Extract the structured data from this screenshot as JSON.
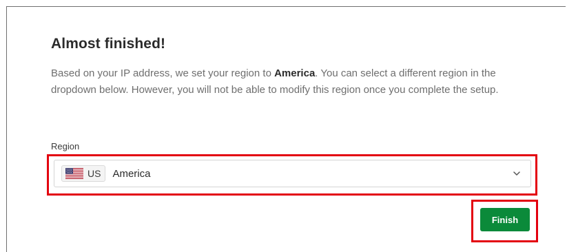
{
  "dialog": {
    "title": "Almost finished!",
    "description_before": "Based on your IP address, we set your region to ",
    "description_region": "America",
    "description_after": ". You can select a different region in the dropdown below. However, you will not be able to modify this region once you complete the setup."
  },
  "region_field": {
    "label": "Region",
    "selected_code": "US",
    "selected_name": "America",
    "flag_icon": "us-flag-icon",
    "dropdown_icon": "chevron-down-icon"
  },
  "actions": {
    "finish_label": "Finish"
  },
  "colors": {
    "accent_green": "#0b8a3a",
    "highlight_red": "#e3000f",
    "title_text": "#2b2b2b",
    "body_text": "#6e6e6e"
  }
}
